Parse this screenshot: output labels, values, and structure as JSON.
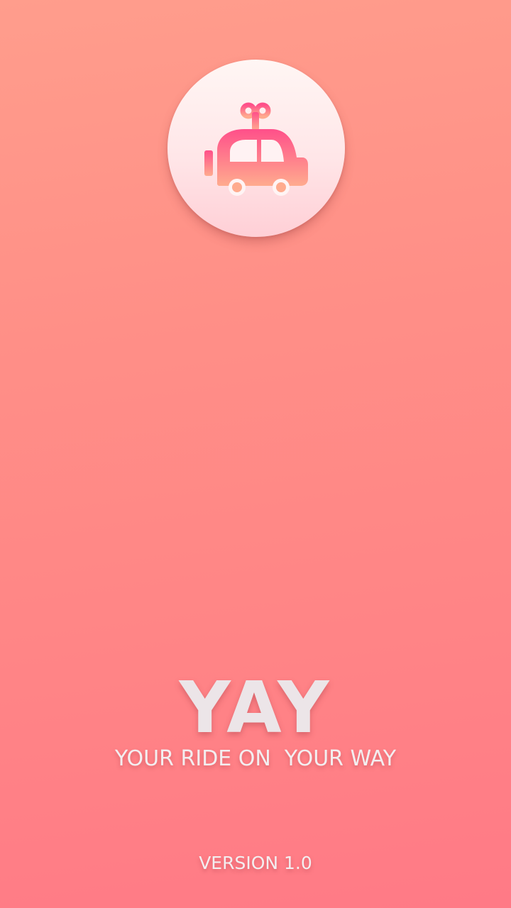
{
  "app": {
    "logo_icon": "wind-up-toy-car-icon",
    "name": "YAY",
    "tagline": "YOUR RIDE ON  YOUR WAY",
    "version": "VERSION 1.0"
  },
  "colors": {
    "background_top": "#ff9d8c",
    "background_bottom": "#ff7a86",
    "text": "#ece5e8",
    "icon_pink": "#ff4f8a",
    "icon_peach": "#ffab8e"
  }
}
